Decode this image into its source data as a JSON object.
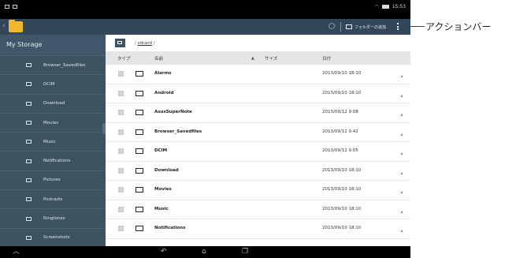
{
  "statusbar": {
    "time": "15:53"
  },
  "actionbar": {
    "new_folder_label": "フォルダーの追加"
  },
  "sidebar": {
    "title": "My Storage",
    "items": [
      {
        "label": "Browser_Savedfiles"
      },
      {
        "label": "DCIM"
      },
      {
        "label": "Download"
      },
      {
        "label": "Movies"
      },
      {
        "label": "Music"
      },
      {
        "label": "Notifications"
      },
      {
        "label": "Pictures"
      },
      {
        "label": "Podcasts"
      },
      {
        "label": "Ringtones"
      },
      {
        "label": "Screenshots"
      }
    ]
  },
  "main": {
    "path_sep": "/",
    "path_link": "sdcard",
    "columns": {
      "type": "タイプ",
      "name": "名前",
      "sort_indicator": "▲",
      "size": "サイズ",
      "date": "日付"
    },
    "rows": [
      {
        "name": "Alarms",
        "date": "2013/09/10 18:10"
      },
      {
        "name": "Android",
        "date": "2013/09/10 18:10"
      },
      {
        "name": "AsusSuperNote",
        "date": "2013/09/12 9:08"
      },
      {
        "name": "Browser_Savedfiles",
        "date": "2013/09/12 9:42"
      },
      {
        "name": "DCIM",
        "date": "2013/09/12 9:05"
      },
      {
        "name": "Download",
        "date": "2013/09/10 18:10"
      },
      {
        "name": "Movies",
        "date": "2013/09/10 18:10"
      },
      {
        "name": "Music",
        "date": "2013/09/10 18:10"
      },
      {
        "name": "Notifications",
        "date": "2013/09/10 18:10"
      }
    ]
  },
  "callout": {
    "label": "アクションバー"
  }
}
